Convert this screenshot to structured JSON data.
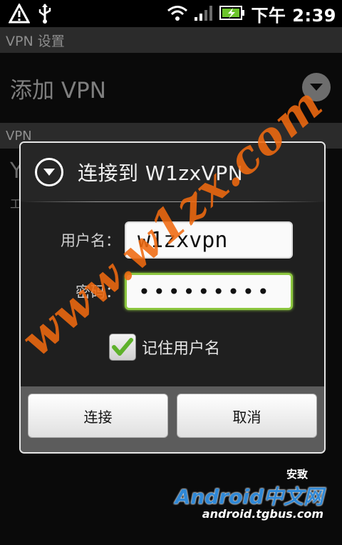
{
  "status_bar": {
    "time": "下午 2:39",
    "icons": [
      "alert-icon",
      "usb-icon",
      "wifi-icon",
      "signal-icon",
      "battery-charging-icon"
    ]
  },
  "settings": {
    "title": "VPN 设置",
    "add_vpn_label": "添加 VPN",
    "vpn_section_label": "VPN",
    "peek_item_initial": "Y",
    "peek_item_sub": "工"
  },
  "dialog": {
    "title": "连接到 W1zxVPN",
    "username_label": "用户名：",
    "username_value": "w1zxvpn",
    "password_label": "密码：",
    "password_value": "•••••••••",
    "remember_label": "记住用户名",
    "remember_checked": true,
    "connect_button": "连接",
    "cancel_button": "取消"
  },
  "watermark": {
    "text": "www.w1zx.com"
  },
  "logo": {
    "top": "安致",
    "main": "Android中文网",
    "sub": "android.tgbus.com"
  },
  "colors": {
    "focus_green": "#8cc63f",
    "watermark_orange": "#f06a10",
    "logo_blue": "#2f88d6"
  }
}
